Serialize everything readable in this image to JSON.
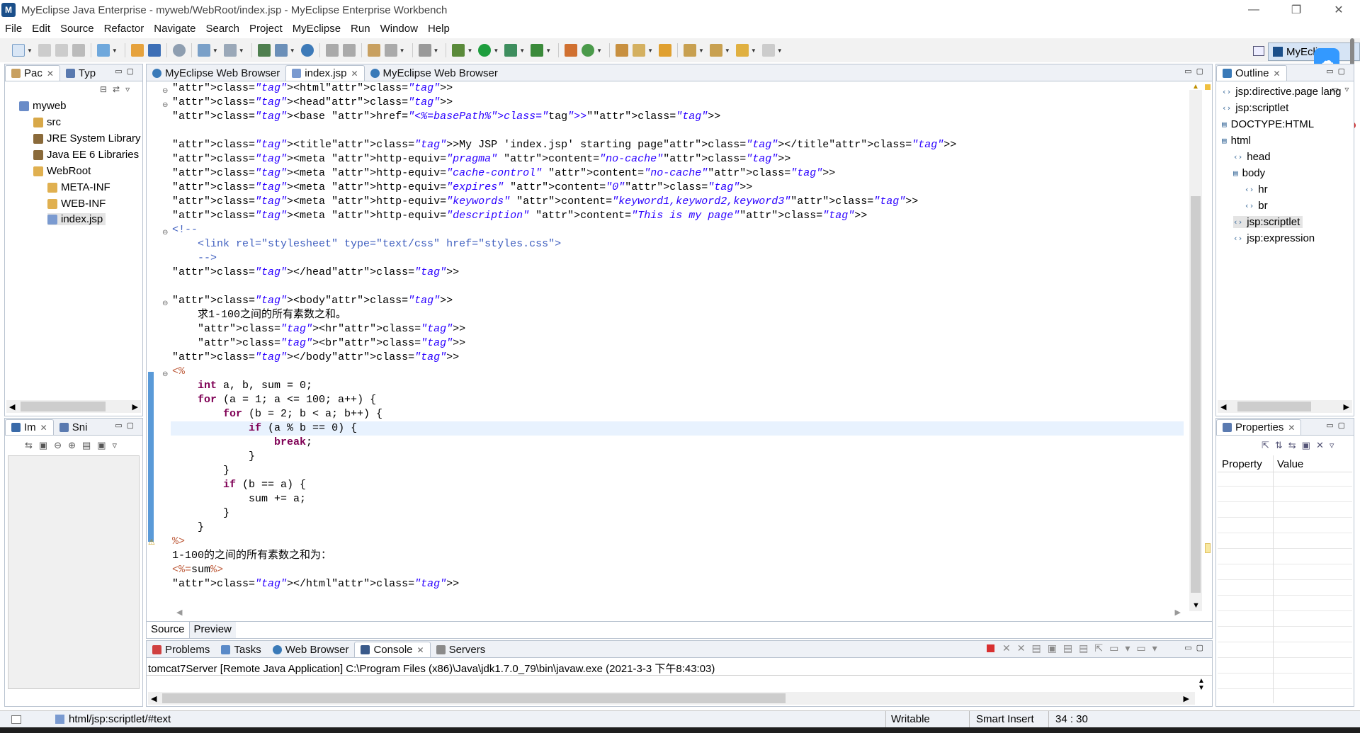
{
  "window": {
    "title": "MyEclipse Java Enterprise - myweb/WebRoot/index.jsp - MyEclipse Enterprise Workbench",
    "minimize": "—",
    "maximize": "❐",
    "close": "✕"
  },
  "menu": [
    "File",
    "Edit",
    "Source",
    "Refactor",
    "Navigate",
    "Search",
    "Project",
    "MyEclipse",
    "Run",
    "Window",
    "Help"
  ],
  "perspective": {
    "label": "MyEcli"
  },
  "package_explorer": {
    "tabs": [
      "Pac",
      "Typ"
    ],
    "tree": [
      {
        "label": "myweb",
        "icon": "project-icon"
      },
      {
        "label": "src",
        "icon": "source-folder-icon"
      },
      {
        "label": "JRE System Library",
        "icon": "library-icon"
      },
      {
        "label": "Java EE 6 Libraries",
        "icon": "library-icon"
      },
      {
        "label": "WebRoot",
        "icon": "folder-icon"
      },
      {
        "label": "META-INF",
        "icon": "folder-icon"
      },
      {
        "label": "WEB-INF",
        "icon": "folder-icon"
      },
      {
        "label": "index.jsp",
        "icon": "jsp-file-icon"
      }
    ]
  },
  "image_panel": {
    "tabs": [
      "Im",
      "Sni"
    ]
  },
  "editor": {
    "tabs": [
      "MyEclipse Web Browser",
      "index.jsp",
      "MyEclipse Web Browser"
    ],
    "bottom_tabs": [
      "Source",
      "Preview"
    ]
  },
  "code_lines": [
    "<html>",
    "<head>",
    "<base href=\"<%=basePath%>\">",
    "",
    "<title>My JSP 'index.jsp' starting page</title>",
    "<meta http-equiv=\"pragma\" content=\"no-cache\">",
    "<meta http-equiv=\"cache-control\" content=\"no-cache\">",
    "<meta http-equiv=\"expires\" content=\"0\">",
    "<meta http-equiv=\"keywords\" content=\"keyword1,keyword2,keyword3\">",
    "<meta http-equiv=\"description\" content=\"This is my page\">",
    "<!--",
    "    <link rel=\"stylesheet\" type=\"text/css\" href=\"styles.css\">",
    "    -->",
    "</head>",
    "",
    "<body>",
    "    求1-100之间的所有素数之和。",
    "    <hr>",
    "    <br>",
    "</body>",
    "<%",
    "    int a, b, sum = 0;",
    "    for (a = 1; a <= 100; a++) {",
    "        for (b = 2; b < a; b++) {",
    "            if (a % b == 0) {",
    "                break;",
    "            }",
    "        }",
    "        if (b == a) {",
    "            sum += a;",
    "        }",
    "    }",
    "%>",
    "1-100的之间的所有素数之和为：",
    "<%=sum%>",
    "</html>"
  ],
  "outline": {
    "tab": "Outline",
    "items": [
      {
        "label": "jsp:directive.page lang"
      },
      {
        "label": "jsp:scriptlet"
      },
      {
        "label": "DOCTYPE:HTML"
      },
      {
        "label": "html"
      },
      {
        "label": "head"
      },
      {
        "label": "body"
      },
      {
        "label": "hr"
      },
      {
        "label": "br"
      },
      {
        "label": "jsp:scriptlet"
      },
      {
        "label": "jsp:expression"
      }
    ]
  },
  "properties": {
    "tab": "Properties",
    "col_property": "Property",
    "col_value": "Value"
  },
  "console": {
    "tabs": [
      "Problems",
      "Tasks",
      "Web Browser",
      "Console",
      "Servers"
    ],
    "text": "tomcat7Server [Remote Java Application] C:\\Program Files (x86)\\Java\\jdk1.7.0_79\\bin\\javaw.exe (2021-3-3 下午8:43:03)"
  },
  "status": {
    "path": "html/jsp:scriptlet/#text",
    "writable": "Writable",
    "insert": "Smart Insert",
    "position": "34 : 30"
  },
  "colors": {
    "accent": "#3399ff",
    "tab_bg": "#eef1f6",
    "tag": "#3f7f7f",
    "attr": "#7f007f",
    "string": "#2a00ff",
    "keyword": "#7f0055"
  }
}
